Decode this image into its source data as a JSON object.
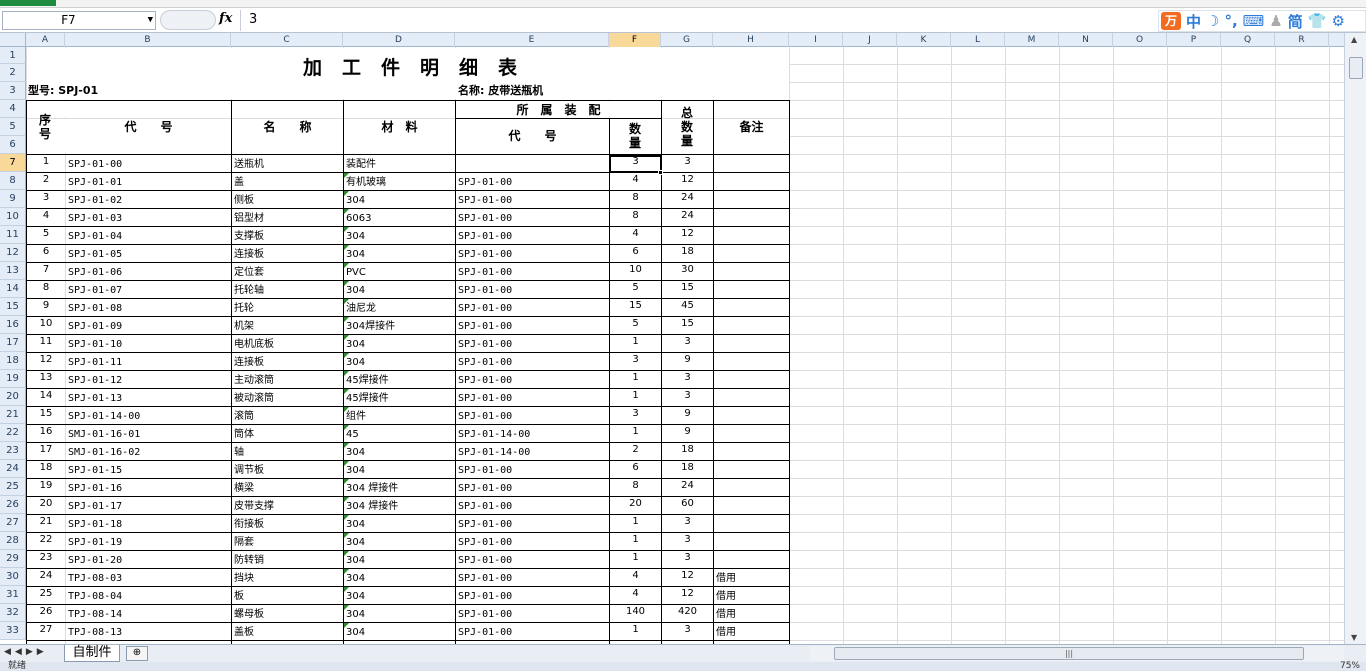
{
  "formula_bar": {
    "name_box": "F7",
    "fx_label": "fx",
    "value": "3"
  },
  "ime": {
    "logo": "万",
    "mode": "中",
    "trad": "简"
  },
  "columns": [
    "A",
    "B",
    "C",
    "D",
    "E",
    "F",
    "G",
    "H",
    "I",
    "J",
    "K",
    "L",
    "M",
    "N",
    "O",
    "P",
    "Q",
    "R"
  ],
  "row_numbers": [
    "1",
    "2",
    "3",
    "4",
    "5",
    "6",
    "7",
    "8",
    "9",
    "10",
    "11",
    "12",
    "13",
    "14",
    "15",
    "16",
    "17",
    "18",
    "19",
    "20",
    "21",
    "22",
    "23",
    "24",
    "25",
    "26",
    "27",
    "28",
    "29",
    "30",
    "31",
    "32",
    "33"
  ],
  "sheet": {
    "title": "加工件明细表",
    "model_label": "型号: SPJ-01",
    "name_label": "名称: 皮带送瓶机",
    "headers": {
      "seq": "序号",
      "code": "代　　号",
      "name": "名　　称",
      "material": "材　料",
      "assembly": "所　属　装　配",
      "asm_code": "代　　号",
      "qty": "数量",
      "total": "总数量",
      "note": "备注"
    },
    "rows": [
      {
        "seq": "1",
        "code": "SPJ-01-00",
        "name": "送瓶机",
        "material": "装配件",
        "asm": "",
        "qty": "3",
        "total": "3",
        "note": ""
      },
      {
        "seq": "2",
        "code": "SPJ-01-01",
        "name": "盖",
        "material": "有机玻璃",
        "asm": "SPJ-01-00",
        "qty": "4",
        "total": "12",
        "note": ""
      },
      {
        "seq": "3",
        "code": "SPJ-01-02",
        "name": "侧板",
        "material": "304",
        "asm": "SPJ-01-00",
        "qty": "8",
        "total": "24",
        "note": ""
      },
      {
        "seq": "4",
        "code": "SPJ-01-03",
        "name": "铝型材",
        "material": "6063",
        "asm": "SPJ-01-00",
        "qty": "8",
        "total": "24",
        "note": ""
      },
      {
        "seq": "5",
        "code": "SPJ-01-04",
        "name": "支撑板",
        "material": "304",
        "asm": "SPJ-01-00",
        "qty": "4",
        "total": "12",
        "note": ""
      },
      {
        "seq": "6",
        "code": "SPJ-01-05",
        "name": "连接板",
        "material": "304",
        "asm": "SPJ-01-00",
        "qty": "6",
        "total": "18",
        "note": ""
      },
      {
        "seq": "7",
        "code": "SPJ-01-06",
        "name": "定位套",
        "material": "PVC",
        "asm": "SPJ-01-00",
        "qty": "10",
        "total": "30",
        "note": ""
      },
      {
        "seq": "8",
        "code": "SPJ-01-07",
        "name": "托轮轴",
        "material": "304",
        "asm": "SPJ-01-00",
        "qty": "5",
        "total": "15",
        "note": ""
      },
      {
        "seq": "9",
        "code": "SPJ-01-08",
        "name": "托轮",
        "material": "油尼龙",
        "asm": "SPJ-01-00",
        "qty": "15",
        "total": "45",
        "note": ""
      },
      {
        "seq": "10",
        "code": "SPJ-01-09",
        "name": "机架",
        "material": "304焊接件",
        "asm": "SPJ-01-00",
        "qty": "5",
        "total": "15",
        "note": ""
      },
      {
        "seq": "11",
        "code": "SPJ-01-10",
        "name": "电机底板",
        "material": "304",
        "asm": "SPJ-01-00",
        "qty": "1",
        "total": "3",
        "note": ""
      },
      {
        "seq": "12",
        "code": "SPJ-01-11",
        "name": "连接板",
        "material": "304",
        "asm": "SPJ-01-00",
        "qty": "3",
        "total": "9",
        "note": ""
      },
      {
        "seq": "13",
        "code": "SPJ-01-12",
        "name": "主动滚筒",
        "material": "45焊接件",
        "asm": "SPJ-01-00",
        "qty": "1",
        "total": "3",
        "note": ""
      },
      {
        "seq": "14",
        "code": "SPJ-01-13",
        "name": "被动滚筒",
        "material": "45焊接件",
        "asm": "SPJ-01-00",
        "qty": "1",
        "total": "3",
        "note": ""
      },
      {
        "seq": "15",
        "code": "SPJ-01-14-00",
        "name": "滚筒",
        "material": "组件",
        "asm": "SPJ-01-00",
        "qty": "3",
        "total": "9",
        "note": ""
      },
      {
        "seq": "16",
        "code": "SMJ-01-16-01",
        "name": "筒体",
        "material": "45",
        "asm": "SPJ-01-14-00",
        "qty": "1",
        "total": "9",
        "note": ""
      },
      {
        "seq": "17",
        "code": "SMJ-01-16-02",
        "name": "轴",
        "material": "304",
        "asm": "SPJ-01-14-00",
        "qty": "2",
        "total": "18",
        "note": ""
      },
      {
        "seq": "18",
        "code": "SPJ-01-15",
        "name": "调节板",
        "material": "304",
        "asm": "SPJ-01-00",
        "qty": "6",
        "total": "18",
        "note": ""
      },
      {
        "seq": "19",
        "code": "SPJ-01-16",
        "name": "横梁",
        "material": "304 焊接件",
        "asm": "SPJ-01-00",
        "qty": "8",
        "total": "24",
        "note": ""
      },
      {
        "seq": "20",
        "code": "SPJ-01-17",
        "name": "皮带支撑",
        "material": "304 焊接件",
        "asm": "SPJ-01-00",
        "qty": "20",
        "total": "60",
        "note": ""
      },
      {
        "seq": "21",
        "code": "SPJ-01-18",
        "name": "衔接板",
        "material": "304",
        "asm": "SPJ-01-00",
        "qty": "1",
        "total": "3",
        "note": ""
      },
      {
        "seq": "22",
        "code": "SPJ-01-19",
        "name": "隔套",
        "material": "304",
        "asm": "SPJ-01-00",
        "qty": "1",
        "total": "3",
        "note": ""
      },
      {
        "seq": "23",
        "code": "SPJ-01-20",
        "name": "防转销",
        "material": "304",
        "asm": "SPJ-01-00",
        "qty": "1",
        "total": "3",
        "note": ""
      },
      {
        "seq": "24",
        "code": "TPJ-08-03",
        "name": "挡块",
        "material": "304",
        "asm": "SPJ-01-00",
        "qty": "4",
        "total": "12",
        "note": "借用"
      },
      {
        "seq": "25",
        "code": "TPJ-08-04",
        "name": "板",
        "material": "304",
        "asm": "SPJ-01-00",
        "qty": "4",
        "total": "12",
        "note": "借用"
      },
      {
        "seq": "26",
        "code": "TPJ-08-14",
        "name": "螺母板",
        "material": "304",
        "asm": "SPJ-01-00",
        "qty": "140",
        "total": "420",
        "note": "借用"
      },
      {
        "seq": "27",
        "code": "TPJ-08-13",
        "name": "盖板",
        "material": "304",
        "asm": "SPJ-01-00",
        "qty": "1",
        "total": "3",
        "note": "借用"
      }
    ]
  },
  "tabs": {
    "active": "自制件"
  },
  "status": {
    "ready": "就绪",
    "zoom": "75%"
  }
}
